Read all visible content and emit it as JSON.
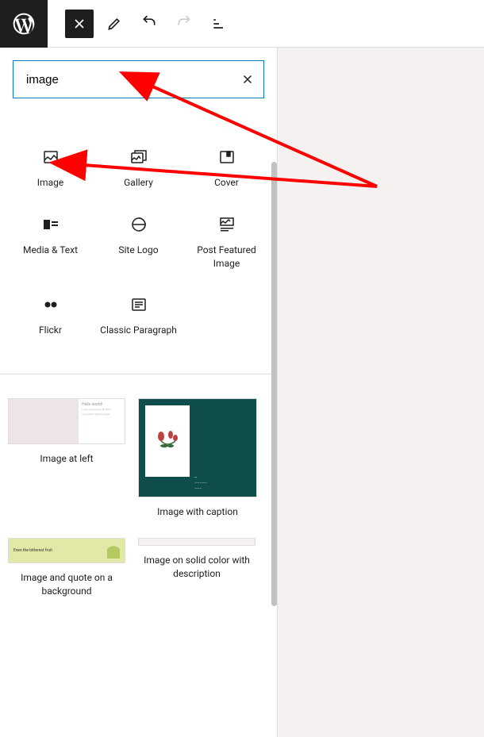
{
  "toolbar": {
    "close_aria": "Close inserter"
  },
  "search": {
    "value": "image",
    "placeholder": "Search"
  },
  "blocks": [
    {
      "label": "Image",
      "icon": "image-icon"
    },
    {
      "label": "Gallery",
      "icon": "gallery-icon"
    },
    {
      "label": "Cover",
      "icon": "cover-icon"
    },
    {
      "label": "Media & Text",
      "icon": "media-text-icon"
    },
    {
      "label": "Site Logo",
      "icon": "site-logo-icon"
    },
    {
      "label": "Post Featured Image",
      "icon": "featured-image-icon"
    },
    {
      "label": "Flickr",
      "icon": "flickr-icon"
    },
    {
      "label": "Classic Paragraph",
      "icon": "classic-paragraph-icon"
    }
  ],
  "patterns": [
    {
      "label": "Image at left"
    },
    {
      "label": "Image with caption"
    },
    {
      "label": "Image and quote on a background"
    },
    {
      "label": "Image on solid color with description"
    }
  ],
  "preview_text": {
    "hello": "Hello world!",
    "quote": "Even the bitterest fruit"
  }
}
